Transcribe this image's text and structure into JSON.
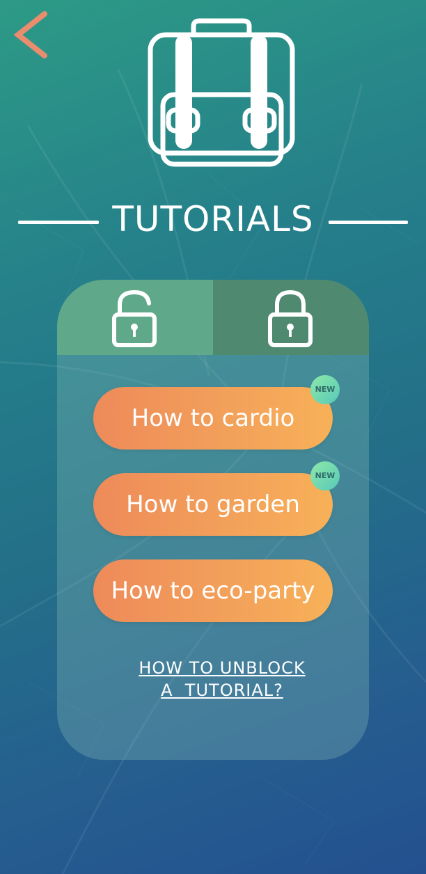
{
  "header": {
    "back_icon": "chevron-left-icon",
    "hero_icon": "backpack-icon",
    "title": "TUTORIALS"
  },
  "tabs": [
    {
      "icon": "unlocked-padlock-icon",
      "state": "unlocked"
    },
    {
      "icon": "locked-padlock-icon",
      "state": "locked"
    }
  ],
  "tutorials": [
    {
      "label": "How to cardio",
      "badge": "NEW"
    },
    {
      "label": "How to garden",
      "badge": "NEW"
    },
    {
      "label": "How to eco-party"
    }
  ],
  "help_link": {
    "line1": "HOW TO UNBLOCK",
    "line2": "A  TUTORIAL?"
  },
  "colors": {
    "accent_back": "#e98d6e",
    "pill_start": "#ee8a5a",
    "pill_end": "#f8b158",
    "badge": "#6fd9b0",
    "tab_unlocked": "#5fa98a",
    "tab_locked": "#4e8970"
  }
}
